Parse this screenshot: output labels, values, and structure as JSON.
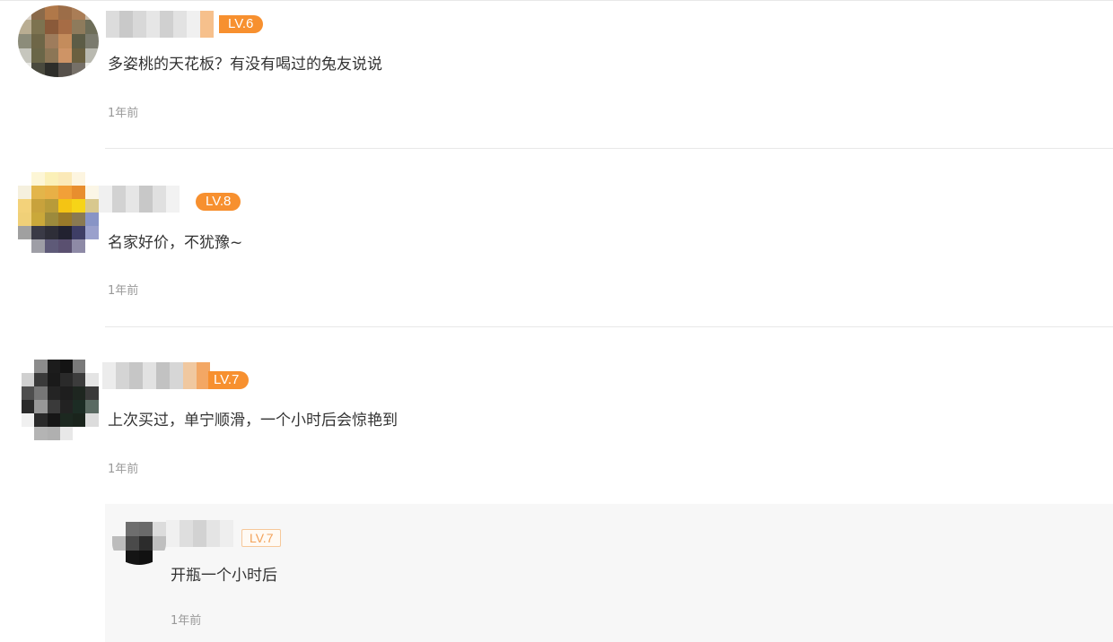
{
  "comments": [
    {
      "level": "LV.6",
      "text": "多姿桃的天花板？有没有喝过的兔友说说",
      "time": "1年前"
    },
    {
      "level": "LV.8",
      "text": "名家好价，不犹豫~",
      "time": "1年前"
    },
    {
      "level": "LV.7",
      "text": "上次买过，单宁顺滑，一个小时后会惊艳到",
      "time": "1年前"
    }
  ],
  "reply": {
    "level": "LV.7",
    "text": "开瓶一个小时后",
    "time": "1年前"
  },
  "colors": {
    "badge_orange": "#f7902f",
    "divider": "#e8e8e8",
    "reply_bg": "#f7f7f7",
    "time_gray": "#999999"
  },
  "icons": [
    "avatar-image",
    "avatar-image",
    "avatar-image",
    "avatar-image"
  ]
}
